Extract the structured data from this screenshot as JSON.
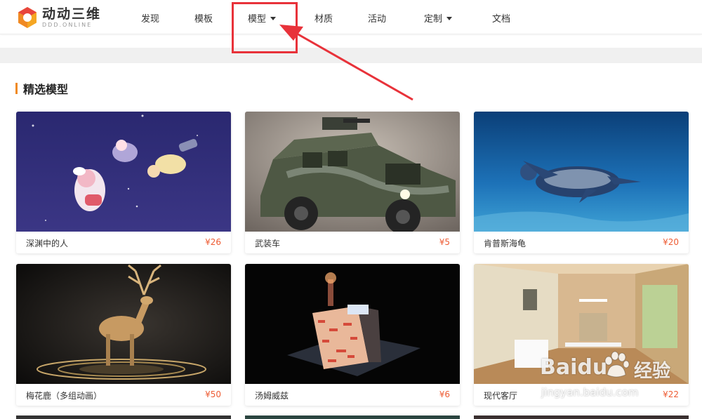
{
  "header": {
    "logo_cn": "动动三维",
    "logo_en": "DDD.ONLINE",
    "nav": [
      {
        "label": "发现",
        "dropdown": false
      },
      {
        "label": "模板",
        "dropdown": false
      },
      {
        "label": "模型",
        "dropdown": true
      },
      {
        "label": "材质",
        "dropdown": false
      },
      {
        "label": "活动",
        "dropdown": false
      },
      {
        "label": "定制",
        "dropdown": true
      },
      {
        "label": "文档",
        "dropdown": false
      }
    ]
  },
  "section": {
    "title": "精选模型"
  },
  "cards": [
    {
      "name": "深渊中的人",
      "price": "¥26",
      "image": "anime-characters-floating-in-purple-sky"
    },
    {
      "name": "武装车",
      "price": "¥5",
      "image": "armored-military-vehicle"
    },
    {
      "name": "肯普斯海龟",
      "price": "¥20",
      "image": "sea-turtle-underwater"
    },
    {
      "name": "梅花鹿（多组动画）",
      "price": "¥50",
      "image": "golden-deer-on-platform"
    },
    {
      "name": "汤姆威兹",
      "price": "¥6",
      "image": "brick-house-diorama"
    },
    {
      "name": "现代客厅",
      "price": "¥22",
      "image": "modern-living-room"
    }
  ],
  "watermark": {
    "brand": "Baidu",
    "brand_cn": "经验",
    "url": "jingyan.baidu.com"
  },
  "colors": {
    "accent": "#f08a24",
    "price": "#ee5c34",
    "annotation": "#e8323a"
  }
}
